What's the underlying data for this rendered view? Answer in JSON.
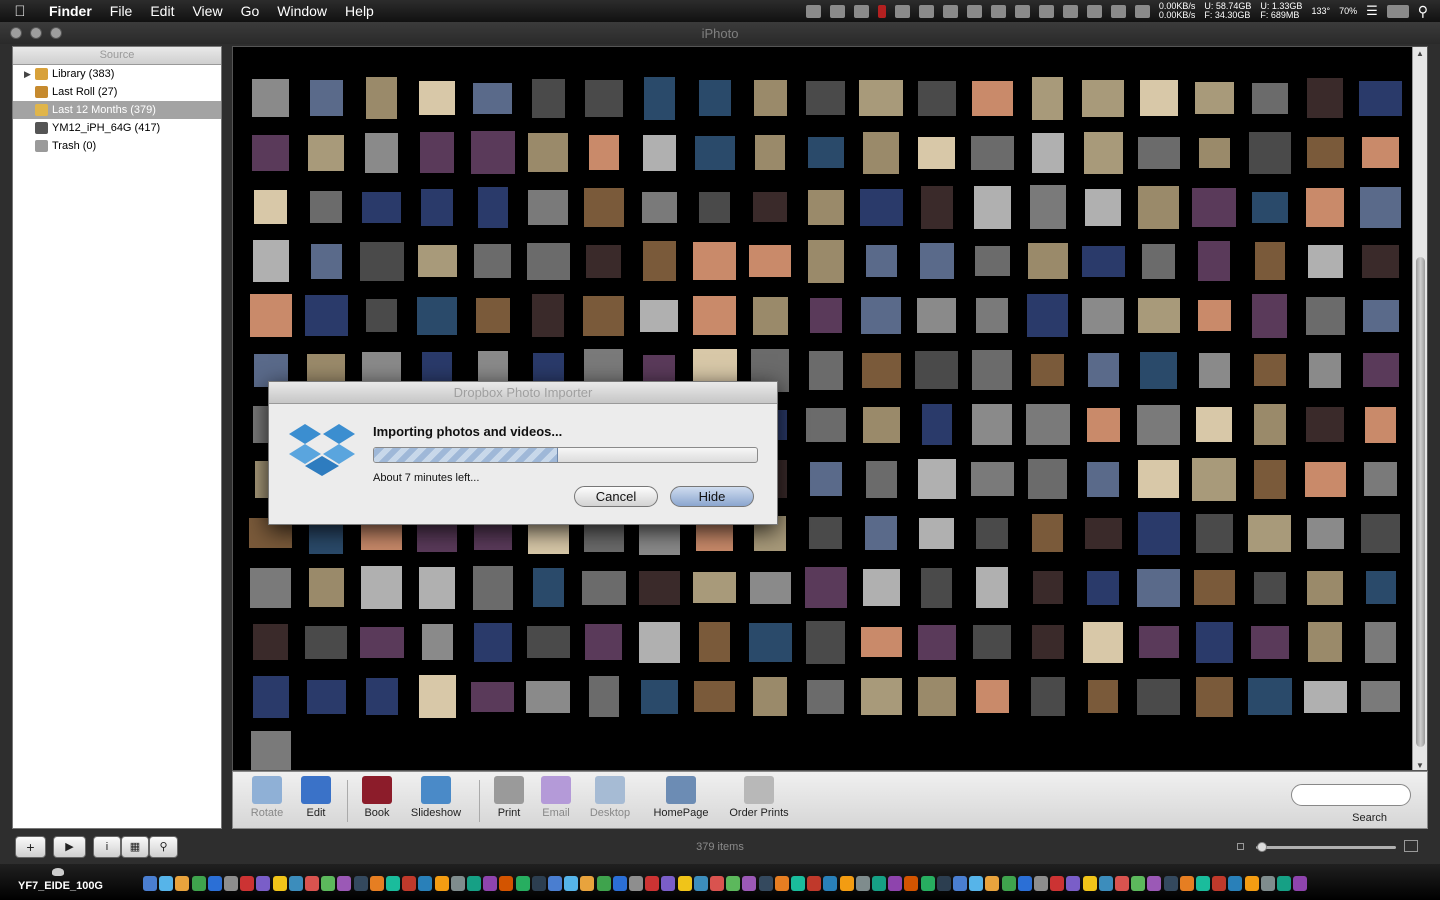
{
  "menubar": {
    "app": "Finder",
    "menus": [
      "File",
      "Edit",
      "View",
      "Go",
      "Window",
      "Help"
    ],
    "status": {
      "net_up": "0.00KB/s",
      "net_down": "0.00KB/s",
      "disk_used": "U: 58.74GB",
      "disk_free": "F: 34.30GB",
      "mem_used": "U: 1.33GB",
      "mem_free": "F: 689MB",
      "temp": "133°",
      "battery": "70%"
    }
  },
  "window": {
    "title": "iPhoto"
  },
  "sidebar": {
    "header": "Source",
    "items": [
      {
        "label": "Library (383)",
        "icon": "library-icon",
        "color": "#d8a13a"
      },
      {
        "label": "Last Roll (27)",
        "icon": "roll-icon",
        "color": "#c68a2e"
      },
      {
        "label": "Last 12 Months (379)",
        "icon": "folder-icon",
        "color": "#e0b54a"
      },
      {
        "label": "YM12_iPH_64G (417)",
        "icon": "camera-icon",
        "color": "#555555"
      },
      {
        "label": "Trash (0)",
        "icon": "trash-icon",
        "color": "#9a9a9a"
      }
    ]
  },
  "toolbar": {
    "tools": [
      {
        "label": "Rotate",
        "icon": "rotate-icon",
        "color": "#8fb0d6",
        "disabled": true
      },
      {
        "label": "Edit",
        "icon": "edit-icon",
        "color": "#3a72c8",
        "disabled": false
      },
      {
        "label": "Book",
        "icon": "book-icon",
        "color": "#8c1c2a",
        "disabled": false
      },
      {
        "label": "Slideshow",
        "icon": "slideshow-icon",
        "color": "#4a8ac8",
        "disabled": false
      },
      {
        "label": "Print",
        "icon": "print-icon",
        "color": "#9a9a9a",
        "disabled": false
      },
      {
        "label": "Email",
        "icon": "email-icon",
        "color": "#b49ad8",
        "disabled": true
      },
      {
        "label": "Desktop",
        "icon": "desktop-icon",
        "color": "#a6bbd4",
        "disabled": true
      },
      {
        "label": "HomePage",
        "icon": "homepage-icon",
        "color": "#6c8cb4",
        "disabled": false
      },
      {
        "label": "Order Prints",
        "icon": "order-prints-icon",
        "color": "#b8b8b8",
        "disabled": false
      }
    ],
    "search_label": "Search"
  },
  "bottom": {
    "item_count": "379 items"
  },
  "dock": {
    "disk_label": "YF7_EIDE_100G",
    "icon_colors": [
      "#4a7ed0",
      "#56b4e9",
      "#e8a33d",
      "#3fa34d",
      "#2b6fd6",
      "#8e8e8e",
      "#cc3333",
      "#7a5ec8",
      "#f0c419",
      "#3c8dbc",
      "#d9534f",
      "#5cb85c",
      "#9b59b6",
      "#34495e",
      "#e67e22",
      "#1abc9c",
      "#c0392b",
      "#2980b9",
      "#f39c12",
      "#7f8c8d",
      "#16a085",
      "#8e44ad",
      "#d35400",
      "#27ae60",
      "#2c3e50"
    ]
  },
  "dialog": {
    "title": "Dropbox Photo Importer",
    "message": "Importing photos and videos...",
    "progress_fraction": 0.48,
    "eta": "About 7 minutes left...",
    "cancel_label": "Cancel",
    "hide_label": "Hide"
  }
}
